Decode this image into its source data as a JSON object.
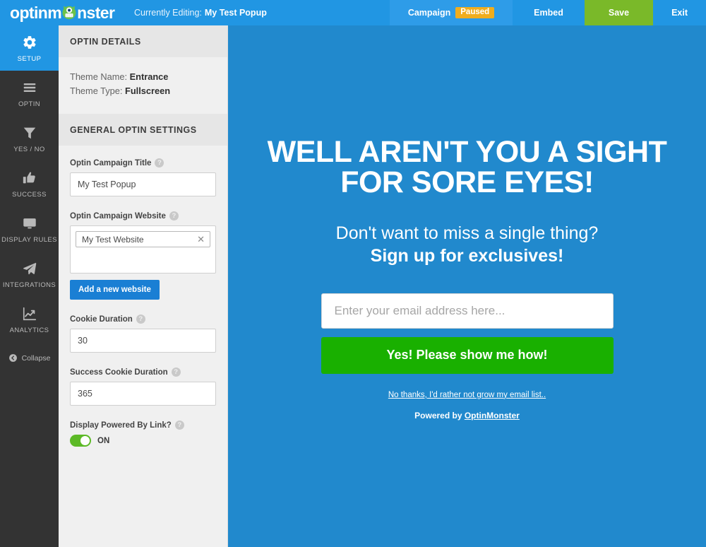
{
  "topbar": {
    "logo_text_before": "optinm",
    "logo_icon": "monster-icon",
    "logo_text_after": "nster",
    "editing_prefix": "Currently Editing:",
    "editing_name": "My Test Popup",
    "campaign_label": "Campaign",
    "campaign_status": "Paused",
    "embed_label": "Embed",
    "save_label": "Save",
    "exit_label": "Exit",
    "brand_blue": "#2196e3",
    "save_green": "#7ab929",
    "paused_amber": "#f0ad1e"
  },
  "sidebar": {
    "items": [
      {
        "label": "SETUP",
        "icon": "gear-icon",
        "active": true
      },
      {
        "label": "OPTIN",
        "icon": "hamburger-icon",
        "active": false
      },
      {
        "label": "YES / NO",
        "icon": "funnel-icon",
        "active": false
      },
      {
        "label": "SUCCESS",
        "icon": "thumbs-up-icon",
        "active": false
      },
      {
        "label": "DISPLAY RULES",
        "icon": "monitor-icon",
        "active": false
      },
      {
        "label": "INTEGRATIONS",
        "icon": "paper-plane-icon",
        "active": false
      },
      {
        "label": "ANALYTICS",
        "icon": "chart-line-icon",
        "active": false
      }
    ],
    "collapse_label": "Collapse",
    "collapse_icon": "circle-arrow-left-icon",
    "background": "#333333"
  },
  "panel": {
    "details_header": "OPTIN DETAILS",
    "theme_name_label": "Theme Name:",
    "theme_name_value": "Entrance",
    "theme_type_label": "Theme Type:",
    "theme_type_value": "Fullscreen",
    "general_header": "GENERAL OPTIN SETTINGS",
    "campaign_title_label": "Optin Campaign Title",
    "campaign_title_value": "My Test Popup",
    "campaign_website_label": "Optin Campaign Website",
    "campaign_website_value": "My Test Website",
    "remove_website_icon": "close-x-icon",
    "add_website_label": "Add a new website",
    "cookie_duration_label": "Cookie Duration",
    "cookie_duration_value": "30",
    "success_cookie_label": "Success Cookie Duration",
    "success_cookie_value": "365",
    "powered_by_label": "Display Powered By Link?",
    "powered_by_state": "ON",
    "help_glyph": "?"
  },
  "preview": {
    "headline": "WELL AREN'T YOU A SIGHT FOR SORE EYES!",
    "sub_line1": "Don't want to miss a single thing?",
    "sub_line2": "Sign up for exclusives!",
    "email_placeholder": "Enter your email address here...",
    "submit_label": "Yes! Please show me how!",
    "decline_label": "No thanks, I'd rather not grow my email list..",
    "powered_prefix": "Powered by ",
    "powered_brand": "OptinMonster",
    "background": "#2189cd",
    "submit_green": "#19b000"
  }
}
